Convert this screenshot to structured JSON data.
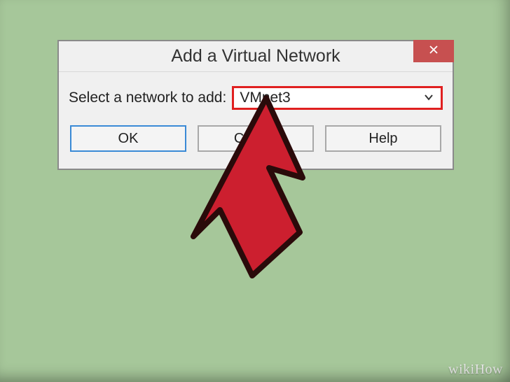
{
  "dialog": {
    "title": "Add a Virtual Network",
    "label": "Select a network to add:",
    "dropdown": {
      "value": "VMnet3"
    },
    "buttons": {
      "ok": "OK",
      "cancel": "Cancel",
      "help": "Help"
    }
  },
  "watermark": "wikiHow",
  "colors": {
    "background": "#a6c79a",
    "close": "#c75050",
    "highlight": "#e02020",
    "primary_border": "#3a8ad6"
  }
}
